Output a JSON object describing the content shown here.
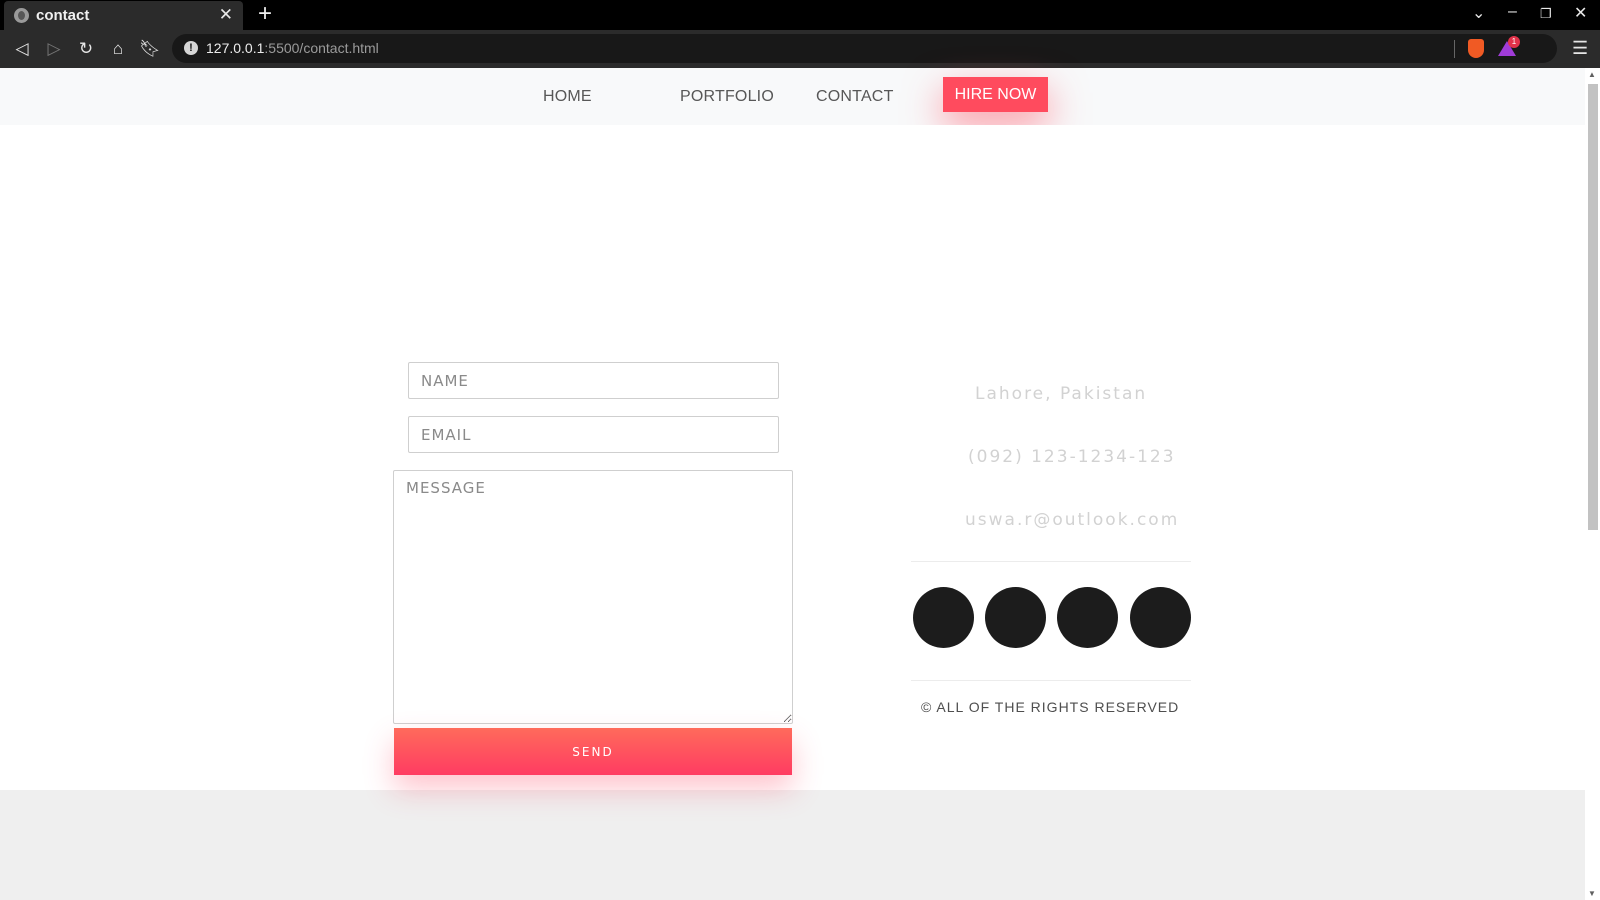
{
  "browser": {
    "tab_title": "contact",
    "tab_close": "✕",
    "new_tab": "+",
    "url_host": "127.0.0.1",
    "url_path": ":5500/contact.html",
    "rewards_count": "1"
  },
  "nav": {
    "home": "HOME",
    "portfolio": "PORTFOLIO",
    "contact": "CONTACT",
    "hire": "HIRE NOW"
  },
  "form": {
    "name_placeholder": "NAME",
    "email_placeholder": "EMAIL",
    "message_placeholder": "MESSAGE",
    "send_label": "SEND"
  },
  "contact_info": {
    "location": "Lahore, Pakistan",
    "phone": "(092) 123-1234-123",
    "email": "uswa.r@outlook.com"
  },
  "footer": {
    "rights": "© ALL OF THE RIGHTS RESERVED"
  },
  "colors": {
    "accent": "#ff4b5e",
    "social_circle": "#1c1c1c"
  }
}
